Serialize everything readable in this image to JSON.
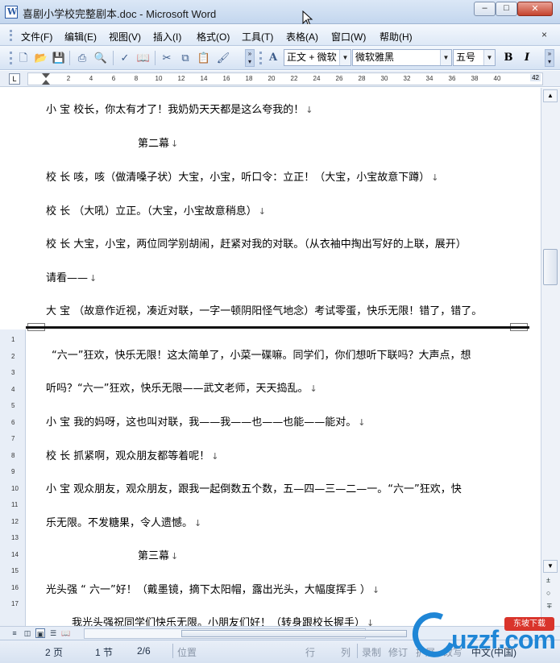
{
  "window": {
    "title": "喜剧小学校完整剧本.doc - Microsoft Word",
    "minimize": "–",
    "maximize": "□",
    "close": "✕"
  },
  "menu": {
    "items": [
      "文件(F)",
      "编辑(E)",
      "视图(V)",
      "插入(I)",
      "格式(O)",
      "工具(T)",
      "表格(A)",
      "窗口(W)",
      "帮助(H)"
    ],
    "mdi_close": "×"
  },
  "toolbar": {
    "style_value": "正文 + 微软",
    "font_value": "微软雅黑",
    "size_value": "五号",
    "bold": "B",
    "italic": "I",
    "style_icon": "A"
  },
  "ruler": {
    "ticks": [
      "2",
      "4",
      "6",
      "8",
      "10",
      "12",
      "14",
      "16",
      "18",
      "20",
      "22",
      "24",
      "26",
      "28",
      "30",
      "32",
      "34",
      "36",
      "38",
      "40"
    ],
    "end_value": "42",
    "corner": "L"
  },
  "vruler": {
    "ticks": [
      "1",
      "2",
      "3",
      "4",
      "5",
      "6",
      "7",
      "8",
      "9",
      "10",
      "11",
      "12",
      "13",
      "14",
      "15",
      "16",
      "17"
    ]
  },
  "document": {
    "lines": [
      "小 宝  校长，你太有才了！我奶奶天天都是这么夸我的！",
      "第二幕",
      "校 长  咳，咳（做清嗓子状）大宝，小宝，听口令：立正！（大宝，小宝故意下蹲）",
      "校 长  （大吼）立正。（大宝，小宝故意稍息）",
      "校 长  大宝，小宝，两位同学别胡闹，赶紧对我的对联。（从衣袖中掏出写好的上联，展开）",
      "请看——",
      "大 宝  （故意作近视，凑近对联，一字一顿阴阳怪气地念）考试零蛋，快乐无限！错了，错了。",
      "“六一”狂欢，快乐无限！这太简单了，小菜一碟嘛。同学们，你们想听下联吗？大声点，想",
      "听吗？“六一”狂欢，快乐无限——武文老师，天天捣乱。",
      "小 宝  我的妈呀，这也叫对联，我——我——也——也能——能对。",
      "校 长  抓紧啊，观众朋友都等着呢！",
      "小 宝  观众朋友，观众朋友，跟我一起倒数五个数，五—四—三—二—一。“六一”狂欢，快",
      "乐无限。不发糖果，令人遗憾。",
      "第三幕",
      "光头强  “ 六一”好！（戴墨镜，摘下太阳帽，露出光头，大幅度挥手  ）",
      "我光头强祝同学们快乐无限。小朋友们好！（转身跟校长握手）"
    ],
    "paragraph_mark": "↓"
  },
  "scrollbar": {
    "up": "▲",
    "down": "▼",
    "prev_page": "±",
    "select_browse": "○",
    "next_page": "∓"
  },
  "statusbar": {
    "page": "2 页",
    "section": "1 节",
    "page_of": "2/6",
    "position": "位置",
    "line": "行",
    "column": "列",
    "record": "录制",
    "revise": "修订",
    "extend": "扩展",
    "overtype": "改写",
    "language": "中文(中国)"
  },
  "logo": {
    "word": "uzzf.com",
    "tag": "东坡下载"
  },
  "colors": {
    "accent": "#1f86d6",
    "logo_tag": "#d9342b",
    "chrome": "#dde8f6"
  }
}
